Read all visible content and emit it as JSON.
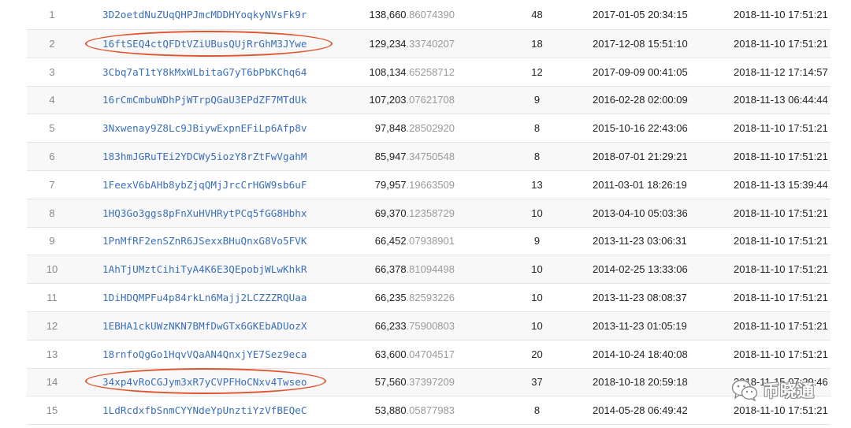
{
  "rows": [
    {
      "rank": "1",
      "address": "3D2oetdNuZUqQHPJmcMDDHYoqkyNVsFk9r",
      "balance_int": "138,660",
      "balance_dec": ".86074390",
      "tx_count": "48",
      "first_seen": "2017-01-05 20:34:15",
      "last_seen": "2018-11-10 17:51:21"
    },
    {
      "rank": "2",
      "address": "16ftSEQ4ctQFDtVZiUBusQUjRrGhM3JYwe",
      "balance_int": "129,234",
      "balance_dec": ".33740207",
      "tx_count": "18",
      "first_seen": "2017-12-08 15:51:10",
      "last_seen": "2018-11-10 17:51:21"
    },
    {
      "rank": "3",
      "address": "3Cbq7aT1tY8kMxWLbitaG7yT6bPbKChq64",
      "balance_int": "108,134",
      "balance_dec": ".65258712",
      "tx_count": "12",
      "first_seen": "2017-09-09 00:41:05",
      "last_seen": "2018-11-12 17:14:57"
    },
    {
      "rank": "4",
      "address": "16rCmCmbuWDhPjWTrpQGaU3EPdZF7MTdUk",
      "balance_int": "107,203",
      "balance_dec": ".07621708",
      "tx_count": "9",
      "first_seen": "2016-02-28 02:00:09",
      "last_seen": "2018-11-13 06:44:44"
    },
    {
      "rank": "5",
      "address": "3Nxwenay9Z8Lc9JBiywExpnEFiLp6Afp8v",
      "balance_int": "97,848",
      "balance_dec": ".28502920",
      "tx_count": "8",
      "first_seen": "2015-10-16 22:43:06",
      "last_seen": "2018-11-10 17:51:21"
    },
    {
      "rank": "6",
      "address": "183hmJGRuTEi2YDCWy5iozY8rZtFwVgahM",
      "balance_int": "85,947",
      "balance_dec": ".34750548",
      "tx_count": "8",
      "first_seen": "2018-07-01 21:29:21",
      "last_seen": "2018-11-10 17:51:21"
    },
    {
      "rank": "7",
      "address": "1FeexV6bAHb8ybZjqQMjJrcCrHGW9sb6uF",
      "balance_int": "79,957",
      "balance_dec": ".19663509",
      "tx_count": "13",
      "first_seen": "2011-03-01 18:26:19",
      "last_seen": "2018-11-13 15:39:44"
    },
    {
      "rank": "8",
      "address": "1HQ3Go3ggs8pFnXuHVHRytPCq5fGG8Hbhx",
      "balance_int": "69,370",
      "balance_dec": ".12358729",
      "tx_count": "10",
      "first_seen": "2013-04-10 05:03:36",
      "last_seen": "2018-11-10 17:51:21"
    },
    {
      "rank": "9",
      "address": "1PnMfRF2enSZnR6JSexxBHuQnxG8Vo5FVK",
      "balance_int": "66,452",
      "balance_dec": ".07938901",
      "tx_count": "9",
      "first_seen": "2013-11-23 03:06:31",
      "last_seen": "2018-11-10 17:51:21"
    },
    {
      "rank": "10",
      "address": "1AhTjUMztCihiTyA4K6E3QEpobjWLwKhkR",
      "balance_int": "66,378",
      "balance_dec": ".81094498",
      "tx_count": "10",
      "first_seen": "2014-02-25 13:33:06",
      "last_seen": "2018-11-10 17:51:21"
    },
    {
      "rank": "11",
      "address": "1DiHDQMPFu4p84rkLn6Majj2LCZZZRQUaa",
      "balance_int": "66,235",
      "balance_dec": ".82593226",
      "tx_count": "10",
      "first_seen": "2013-11-23 08:08:37",
      "last_seen": "2018-11-10 17:51:21"
    },
    {
      "rank": "12",
      "address": "1EBHA1ckUWzNKN7BMfDwGTx6GKEbADUozX",
      "balance_int": "66,233",
      "balance_dec": ".75900803",
      "tx_count": "10",
      "first_seen": "2013-11-23 01:05:19",
      "last_seen": "2018-11-10 17:51:21"
    },
    {
      "rank": "13",
      "address": "18rnfoQgGo1HqvVQaAN4QnxjYE7Sez9eca",
      "balance_int": "63,600",
      "balance_dec": ".04704517",
      "tx_count": "20",
      "first_seen": "2014-10-24 18:40:08",
      "last_seen": "2018-11-10 17:51:21"
    },
    {
      "rank": "14",
      "address": "34xp4vRoCGJym3xR7yCVPFHoCNxv4Twseo",
      "balance_int": "57,560",
      "balance_dec": ".37397209",
      "tx_count": "37",
      "first_seen": "2018-10-18 20:59:18",
      "last_seen": "2018-11-15 07:29:46"
    },
    {
      "rank": "15",
      "address": "1LdRcdxfbSnmCYYNdeYpUnztiYzVfBEQeC",
      "balance_int": "53,880",
      "balance_dec": ".05877983",
      "tx_count": "8",
      "first_seen": "2014-05-28 06:49:42",
      "last_seen": "2018-11-10 17:51:21"
    }
  ],
  "highlight_color": "#e0542e",
  "watermark": {
    "text": "币晓通",
    "icon": "wechat-icon"
  }
}
